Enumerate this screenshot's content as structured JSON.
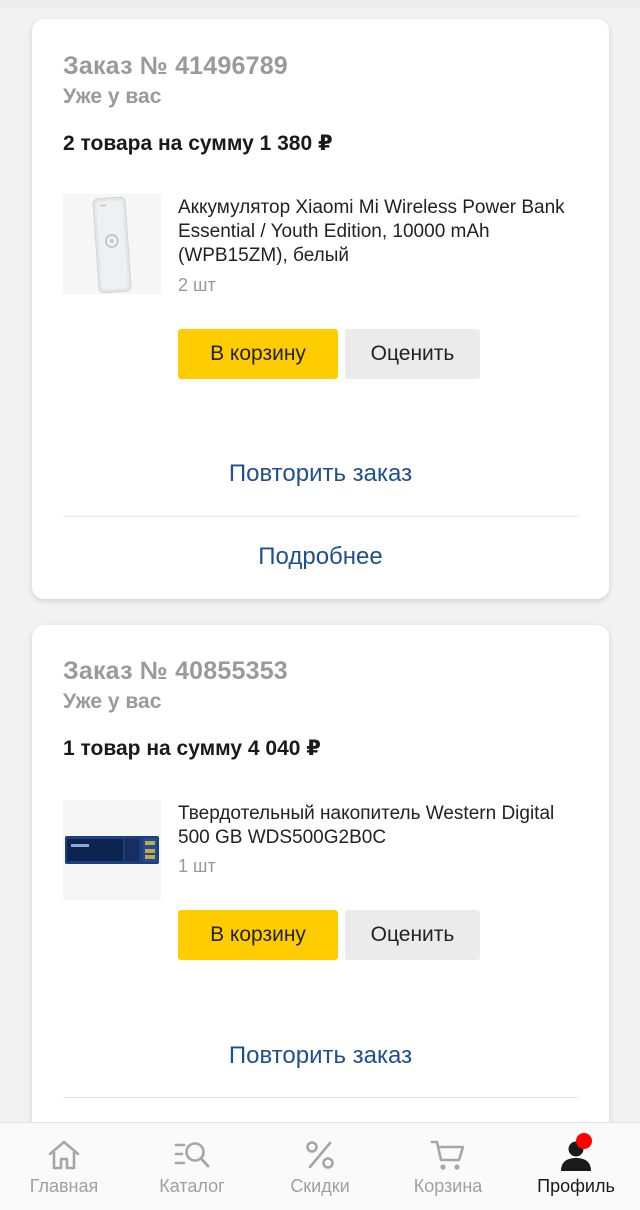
{
  "orders": [
    {
      "title": "Заказ № 41496789",
      "status": "Уже у вас",
      "summary": "2 товара на сумму 1 380 ₽",
      "product": {
        "name": "Аккумулятор Xiaomi Mi Wireless Power Bank Essential / Youth Edition, 10000 mAh (WPB15ZM), белый",
        "qty": "2 шт",
        "thumb_icon": "power-bank-image"
      },
      "cart_label": "В корзину",
      "rate_label": "Оценить",
      "repeat_label": "Повторить заказ",
      "details_label": "Подробнее"
    },
    {
      "title": "Заказ № 40855353",
      "status": "Уже у вас",
      "summary": "1 товар на сумму 4 040 ₽",
      "product": {
        "name": "Твердотельный накопитель Western Digital 500 GB WDS500G2B0C",
        "qty": "1 шт",
        "thumb_icon": "ssd-image"
      },
      "cart_label": "В корзину",
      "rate_label": "Оценить",
      "repeat_label": "Повторить заказ"
    }
  ],
  "nav": {
    "items": [
      {
        "label": "Главная",
        "icon": "home-icon"
      },
      {
        "label": "Каталог",
        "icon": "catalog-search-icon"
      },
      {
        "label": "Скидки",
        "icon": "percent-icon"
      },
      {
        "label": "Корзина",
        "icon": "cart-icon"
      },
      {
        "label": "Профиль",
        "icon": "profile-icon",
        "active": true
      }
    ]
  },
  "colors": {
    "accent_button": "#ffcc00",
    "link": "#1f4f8f",
    "notification": "#ff0000"
  }
}
